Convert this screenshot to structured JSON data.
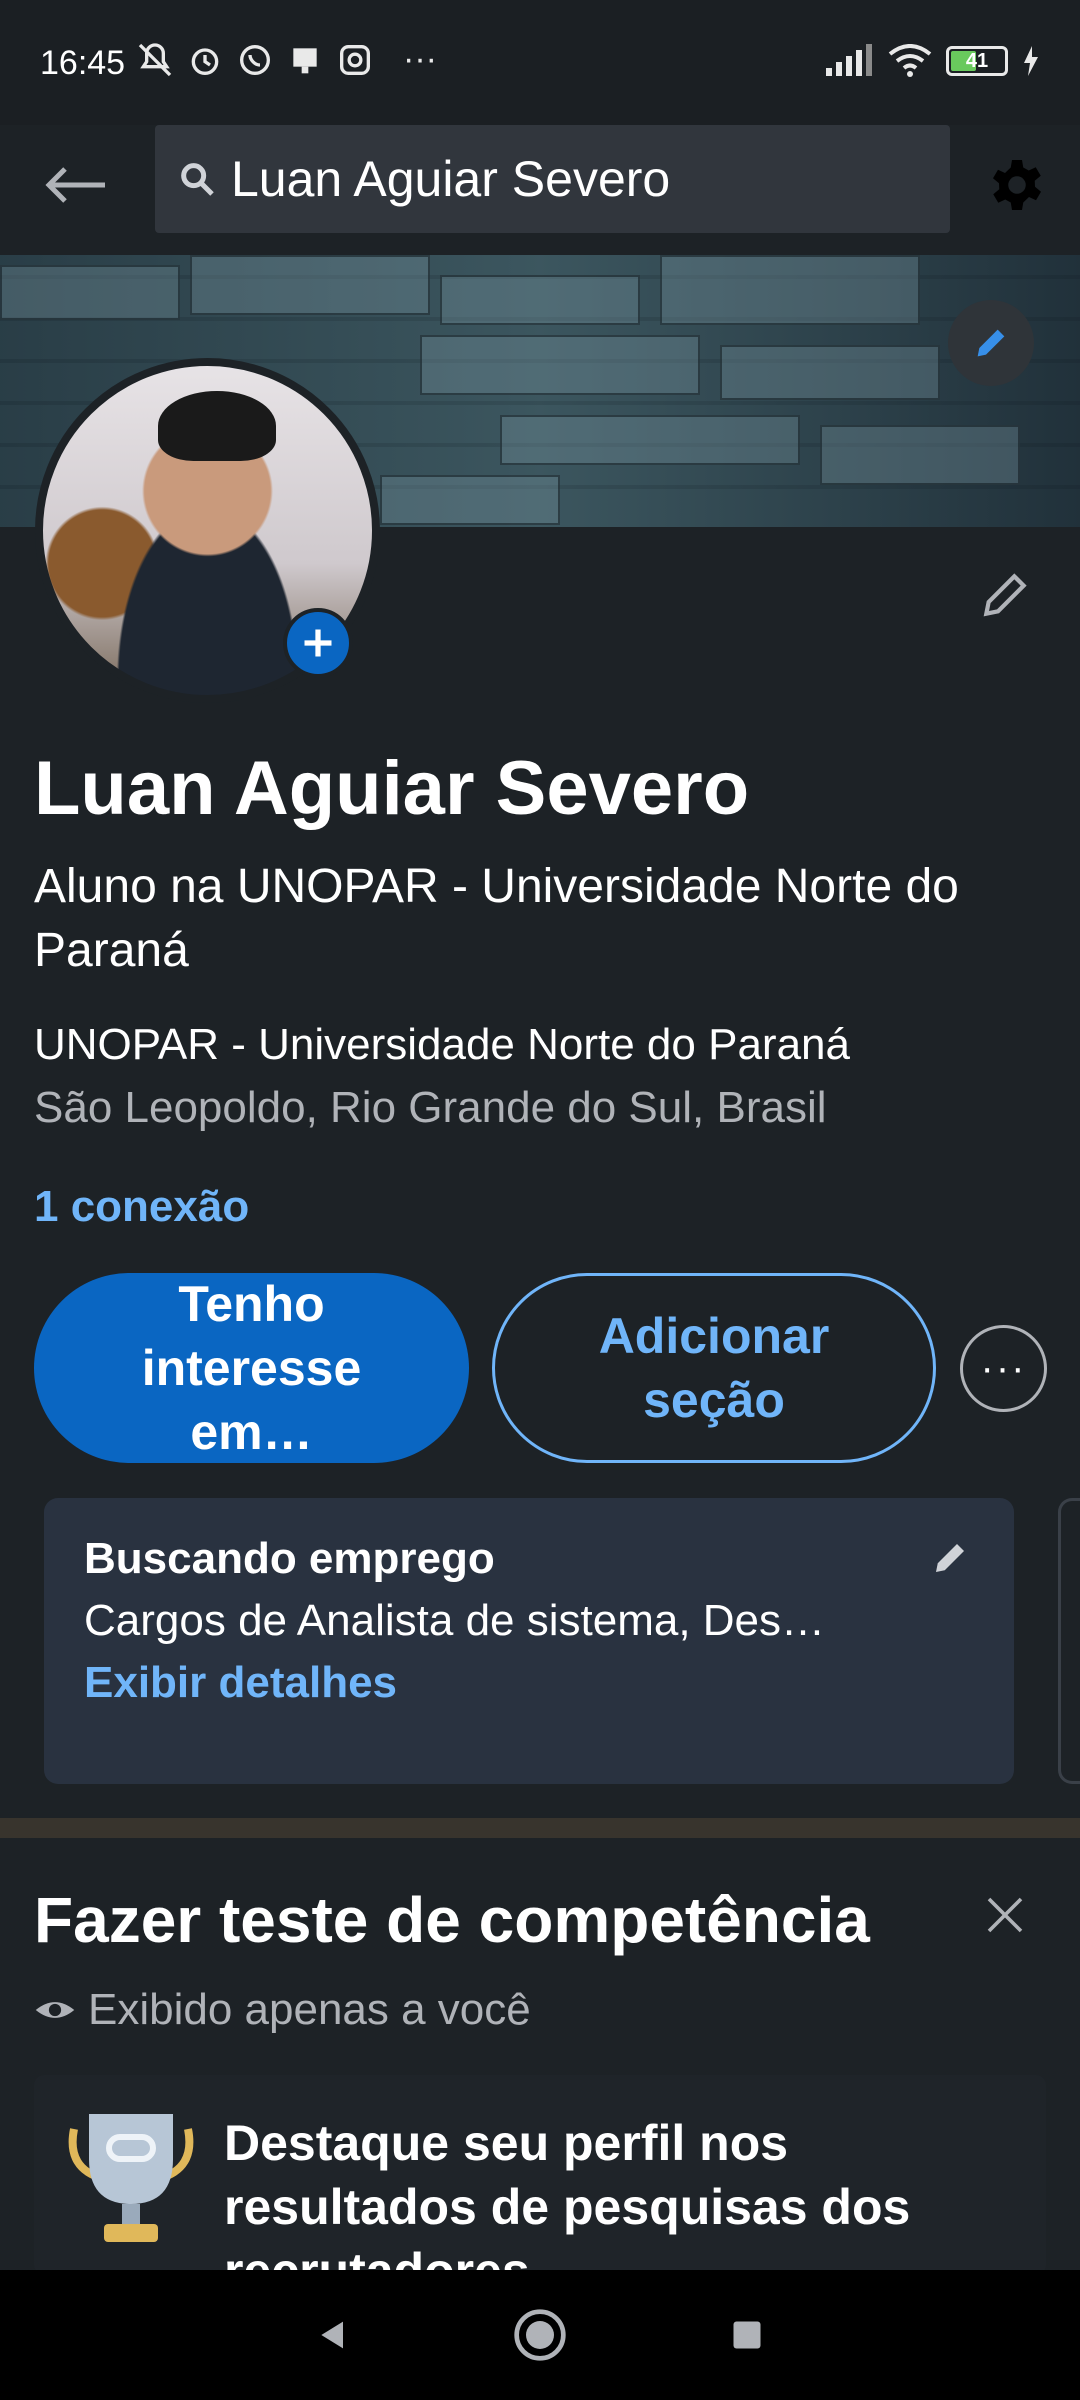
{
  "status_bar": {
    "time": "16:45",
    "left_icons": [
      "muted-icon",
      "alarm-icon",
      "whatsapp-icon",
      "notification-icon",
      "instagram-icon",
      "more-icon"
    ],
    "more_dots": "···",
    "battery": "41"
  },
  "search": {
    "query": "Luan Aguiar Severo"
  },
  "profile": {
    "name": "Luan Aguiar Severo",
    "headline": "Aluno na UNOPAR - Universidade Norte do Paraná",
    "organization": "UNOPAR - Universidade Norte do Paraná",
    "location": "São Leopoldo, Rio Grande do Sul, Brasil",
    "connections": "1 conexão"
  },
  "actions": {
    "primary": "Tenho interesse em…",
    "secondary": "Adicionar seção",
    "more": "···"
  },
  "open_to_work": {
    "title": "Buscando emprego",
    "description": "Cargos de Analista de sistema, Des…",
    "link": "Exibir detalhes"
  },
  "skills": {
    "title": "Fazer teste de competência",
    "visibility": "Exibido apenas a você",
    "promo": "Destaque seu perfil nos resultados de pesquisas dos recrutadores"
  },
  "colors": {
    "background": "#1d2226",
    "accent": "#0a66c2",
    "link": "#70b5f9",
    "card": "#293240"
  }
}
